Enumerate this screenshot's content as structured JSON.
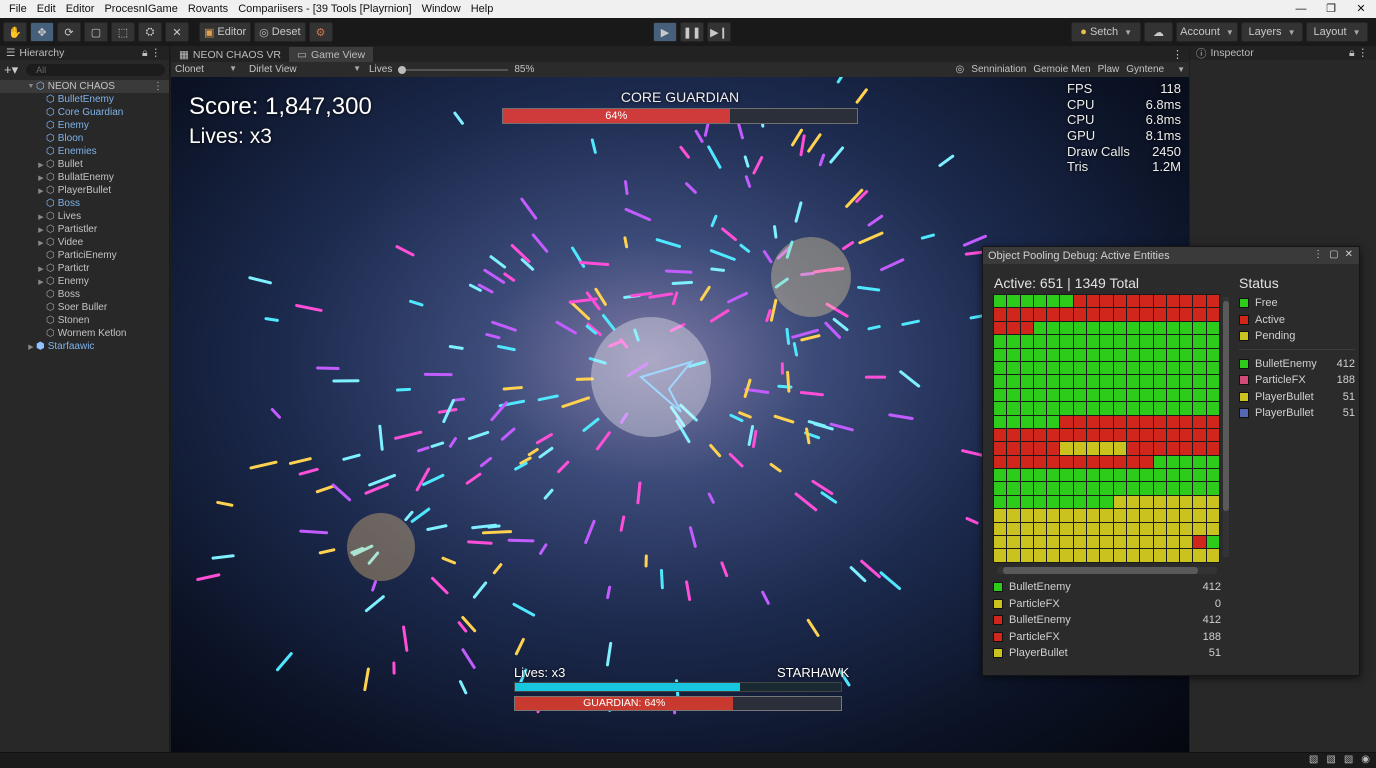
{
  "menu": [
    "File",
    "Edit",
    "Editor",
    "ProcesnIGame",
    "Rovants",
    "Compariisers - [39 Tools [Playrnion]",
    "Window",
    "Help"
  ],
  "window_controls": [
    "—",
    "❐",
    "✕"
  ],
  "toolbar": {
    "editor_label": "Editor",
    "deset_label": "Deset",
    "search_label": "Setch",
    "account_label": "Account",
    "layers_label": "Layers",
    "layout_label": "Layout"
  },
  "hierarchy": {
    "tab_label": "Hierarchy",
    "search_placeholder": "All",
    "root": "NEON CHAOS",
    "items": [
      {
        "label": "BulletEnemy",
        "blue": true,
        "arrow": false
      },
      {
        "label": "Core Guardian",
        "blue": true,
        "arrow": false
      },
      {
        "label": "Enemy",
        "blue": true,
        "arrow": false
      },
      {
        "label": "Bloon",
        "blue": true,
        "arrow": false
      },
      {
        "label": "Enemies",
        "blue": true,
        "arrow": false
      },
      {
        "label": "Bullet",
        "blue": false,
        "arrow": true
      },
      {
        "label": "BullatEnemy",
        "blue": false,
        "arrow": true
      },
      {
        "label": "PlayerBullet",
        "blue": false,
        "arrow": true
      },
      {
        "label": "Boss",
        "blue": true,
        "arrow": false
      },
      {
        "label": "Lives",
        "blue": false,
        "arrow": true
      },
      {
        "label": "Partistler",
        "blue": false,
        "arrow": true
      },
      {
        "label": "Videe",
        "blue": false,
        "arrow": true
      },
      {
        "label": "ParticiEnemy",
        "blue": false,
        "arrow": false
      },
      {
        "label": "Partictr",
        "blue": false,
        "arrow": true
      },
      {
        "label": "Enemy",
        "blue": false,
        "arrow": true
      },
      {
        "label": "Boss",
        "blue": false,
        "arrow": false
      },
      {
        "label": "Soer Buller",
        "blue": false,
        "arrow": false
      },
      {
        "label": "Stonen",
        "blue": false,
        "arrow": false
      },
      {
        "label": "Wornem Ketlon",
        "blue": false,
        "arrow": false
      }
    ],
    "footer_item": "Starfaawic"
  },
  "center": {
    "tabs": [
      "NEON CHAOS VR",
      "Game View"
    ],
    "toolbar": {
      "left1": "Clonet",
      "left2": "Dirlet View",
      "lives_label": "Lives",
      "zoom": "85%",
      "right": [
        "Senniniation",
        "Gemoie Men",
        "Plaw",
        "Gyntene"
      ]
    }
  },
  "hud": {
    "score": "Score: 1,847,300",
    "lives": "Lives: x3",
    "boss_name": "CORE GUARDIAN",
    "boss_health_label": "64%",
    "boss_health": 0.64,
    "stats": [
      {
        "label": "FPS",
        "value": "118"
      },
      {
        "label": "CPU",
        "value": "6.8ms"
      },
      {
        "label": "CPU",
        "value": "6.8ms"
      },
      {
        "label": "GPU",
        "value": "8.1ms"
      },
      {
        "label": "Draw Calls",
        "value": "2450"
      },
      {
        "label": "Tris",
        "value": "1.2M"
      }
    ],
    "bottom_lives": "Lives: x3",
    "bottom_name": "STARHAWK",
    "shield_fill": 0.69,
    "guardian_label": "GUARDIAN: 64%",
    "guardian_fill": 0.67
  },
  "inspector": {
    "tab_label": "Inspector"
  },
  "pool": {
    "title": "Object Pooling Debug: Active Entities",
    "active_text": "Active: 651  |  1349 Total",
    "status_title": "Status",
    "status_legend": [
      {
        "label": "Free",
        "color": "#2ecc1a"
      },
      {
        "label": "Active",
        "color": "#d0261c"
      },
      {
        "label": "Pending",
        "color": "#c9c21f"
      }
    ],
    "type_legend": [
      {
        "label": "BulletEnemy",
        "count": "412",
        "color": "#2ecc1a"
      },
      {
        "label": "ParticleFX",
        "count": "188",
        "color": "#d14a7a"
      },
      {
        "label": "PlayerBullet",
        "count": "51",
        "color": "#c9c21f"
      },
      {
        "label": "PlayerBullet",
        "count": "51",
        "color": "#5567b0"
      }
    ],
    "bottom_list": [
      {
        "label": "BulletEnemy",
        "count": "412",
        "color": "#2ecc1a"
      },
      {
        "label": "ParticleFX",
        "count": "0",
        "color": "#c9c21f"
      },
      {
        "label": "BulletEnemy",
        "count": "412",
        "color": "#d0261c"
      },
      {
        "label": "ParticleFX",
        "count": "188",
        "color": "#d0261c"
      },
      {
        "label": "PlayerBullet",
        "count": "51",
        "color": "#c9c21f"
      }
    ],
    "grid_cols": 17,
    "grid_rows": [
      "ggggggrrrrrrrrrrr",
      "rrrrrrrrrrrrrrrrr",
      "rrrgggggggggggggg",
      "ggggggggggggggggg",
      "ggggggggggggggggg",
      "ggggggggggggggggg",
      "ggggggggggggggggg",
      "ggggggggggggggggg",
      "ggggggggggggggggg",
      "gggggrrrrrrrrrrrr",
      "rrrrrrrrrrrrrrrrr",
      "rrrrryyyyyrrrrrrr",
      "rrrrrrrrrrrrggggg",
      "ggggggggggggggggg",
      "ggggggggggggggggg",
      "gggggggggyyyyyyyy",
      "yyyyyyyyyyyyyyyyy",
      "yyyyyyyyyyyyyyyyy",
      "yyyyyyyyyyyyyyyrg",
      "yyyyyyyyyyyyyyyyy"
    ]
  }
}
